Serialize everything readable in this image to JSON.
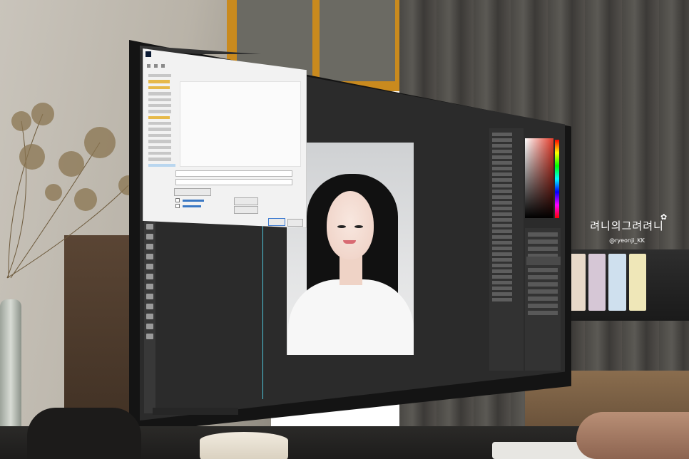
{
  "watermark": {
    "title": "려니의그려려니",
    "handle": "@ryeonji_KK",
    "flower_icon": "✿"
  },
  "colors": {
    "photoshop_bg": "#2b2b2b",
    "dialog_bg": "#f2f2f2",
    "guide_line": "#4fc4d9",
    "portrait_bg": "#e3e4e5",
    "window_frame": "#c98a1e"
  },
  "icons": {
    "dialog_app_icon": "photoshop-icon",
    "tool_icons": "toolbar-tool-icon"
  }
}
